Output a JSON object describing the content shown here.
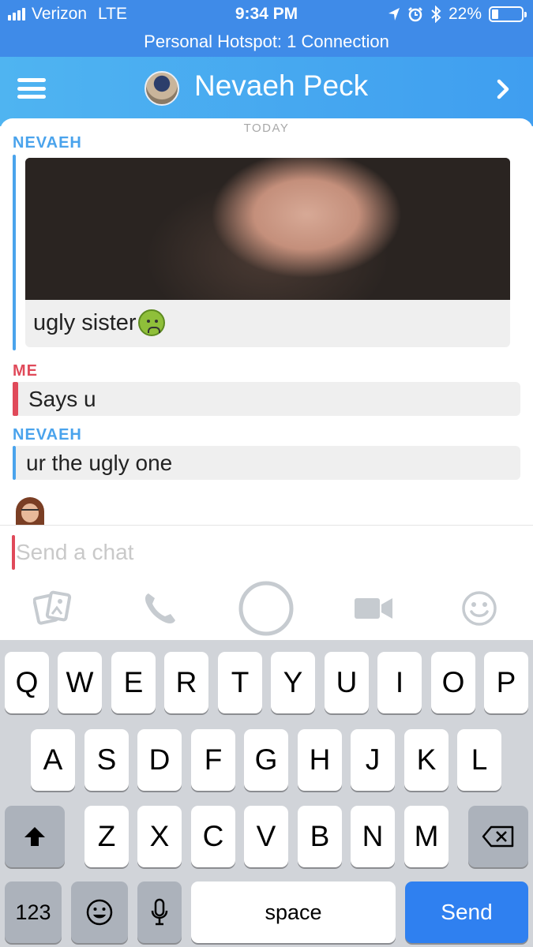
{
  "status_bar": {
    "carrier": "Verizon",
    "network": "LTE",
    "time": "9:34 PM",
    "battery": "22%",
    "battery_level": 0.22,
    "hotspot": "Personal Hotspot: 1 Connection"
  },
  "header": {
    "contact_name": "Nevaeh Peck"
  },
  "chat": {
    "date_label": "TODAY",
    "messages": [
      {
        "sender": "NEVAEH",
        "type": "photo",
        "caption": "ugly sister"
      },
      {
        "sender": "ME",
        "type": "text",
        "text": "Says u"
      },
      {
        "sender": "NEVAEH",
        "type": "text",
        "text": "ur the ugly one"
      }
    ]
  },
  "composer": {
    "placeholder": "Send a chat"
  },
  "toolbar": {
    "icons": [
      "memories-icon",
      "phone-icon",
      "capture-icon",
      "video-icon",
      "emoji-icon"
    ]
  },
  "keyboard": {
    "row1": [
      "Q",
      "W",
      "E",
      "R",
      "T",
      "Y",
      "U",
      "I",
      "O",
      "P"
    ],
    "row2": [
      "A",
      "S",
      "D",
      "F",
      "G",
      "H",
      "J",
      "K",
      "L"
    ],
    "row3": [
      "Z",
      "X",
      "C",
      "V",
      "B",
      "N",
      "M"
    ],
    "numbers_label": "123",
    "space_label": "space",
    "send_label": "Send"
  },
  "colors": {
    "status_bar": "#3f8be8",
    "header": "#4fb4f1",
    "friend": "#4aa3ec",
    "me": "#e04a5a",
    "send_key": "#2f80f0"
  }
}
